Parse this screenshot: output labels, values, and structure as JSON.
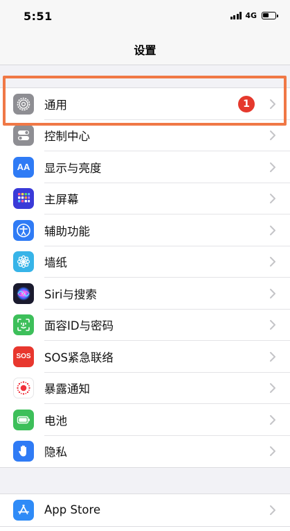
{
  "status": {
    "time": "5:51",
    "network": "4G"
  },
  "nav": {
    "title": "设置"
  },
  "group1": [
    {
      "label": "通用",
      "icon": "gear-icon",
      "badge": "1"
    },
    {
      "label": "控制中心",
      "icon": "toggles-icon"
    },
    {
      "label": "显示与亮度",
      "icon": "text-size-icon"
    },
    {
      "label": "主屏幕",
      "icon": "home-grid-icon"
    },
    {
      "label": "辅助功能",
      "icon": "accessibility-icon"
    },
    {
      "label": "墙纸",
      "icon": "flower-icon"
    },
    {
      "label": "Siri与搜索",
      "icon": "siri-icon"
    },
    {
      "label": "面容ID与密码",
      "icon": "face-id-icon"
    },
    {
      "label": "SOS紧急联络",
      "icon": "sos-icon",
      "icon_text": "SOS"
    },
    {
      "label": "暴露通知",
      "icon": "exposure-icon"
    },
    {
      "label": "电池",
      "icon": "battery-icon"
    },
    {
      "label": "隐私",
      "icon": "hand-icon"
    }
  ],
  "group2": [
    {
      "label": "App Store",
      "icon": "app-store-icon"
    }
  ],
  "icon_aa_text": "AA"
}
